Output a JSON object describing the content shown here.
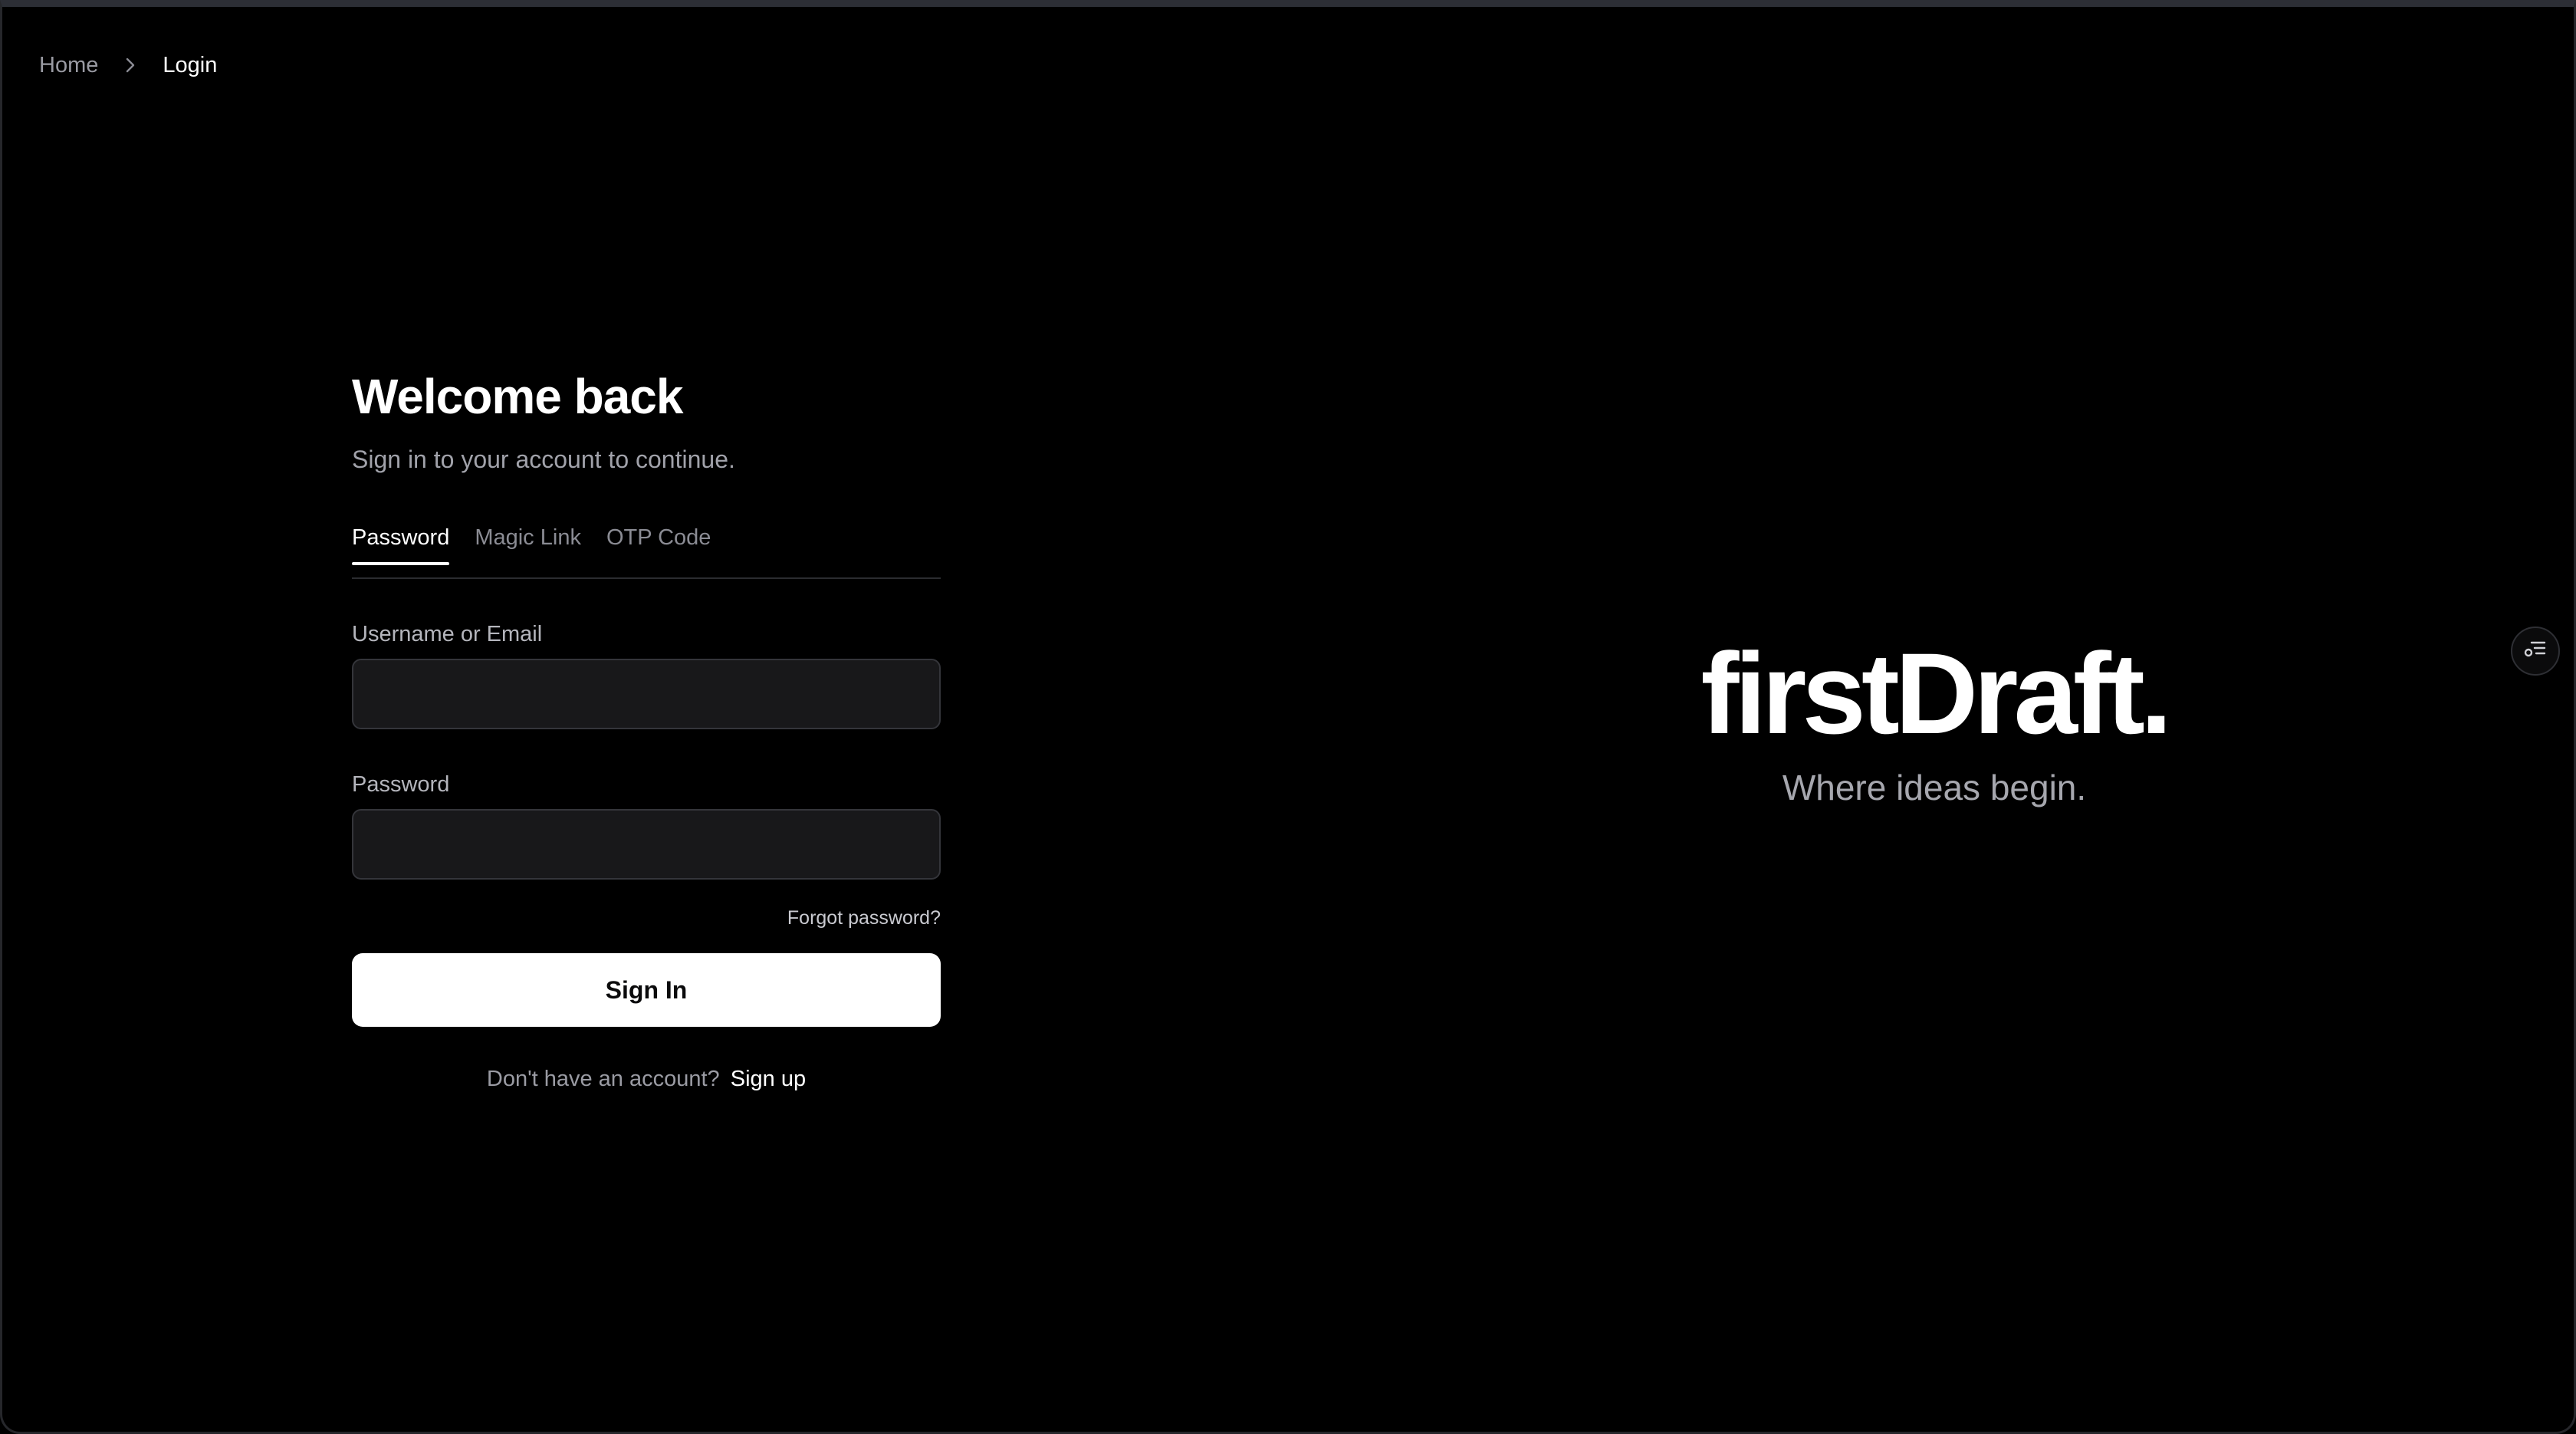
{
  "breadcrumb": {
    "home": "Home",
    "current": "Login",
    "separator_icon": "chevron-right-icon"
  },
  "form": {
    "title": "Welcome back",
    "subtitle": "Sign in to your account to continue.",
    "tabs": [
      {
        "label": "Password",
        "active": true
      },
      {
        "label": "Magic Link",
        "active": false
      },
      {
        "label": "OTP Code",
        "active": false
      }
    ],
    "username_label": "Username or Email",
    "username_value": "",
    "password_label": "Password",
    "password_value": "",
    "forgot_label": "Forgot password?",
    "submit_label": "Sign In",
    "signup_prompt": "Don't have an account?",
    "signup_link": "Sign up"
  },
  "brand": {
    "logo": "firstDraft.",
    "tagline": "Where ideas begin."
  },
  "side_button": {
    "icon": "settings-list-icon"
  },
  "colors": {
    "background": "#000000",
    "input_background": "#18181a",
    "primary_button": "#ffffff",
    "muted_text": "#9a9ba3"
  }
}
